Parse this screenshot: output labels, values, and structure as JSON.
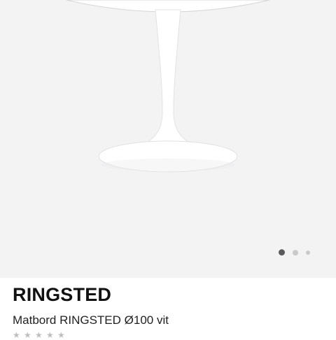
{
  "product": {
    "title": "RINGSTED",
    "subtitle": "Matbord RINGSTED Ø100 vit"
  },
  "gallery": {
    "image_icon": "white-pedestal-table-image",
    "dots_total": 3,
    "active_dot_index": 0
  },
  "rating": {
    "stars_total": 5,
    "star_icon": "star-icon"
  },
  "colors": {
    "background": "#f3f3f4",
    "title": "#111111",
    "dot_active": "#5a5a5c",
    "dot_inactive": "#c9c9cb"
  }
}
